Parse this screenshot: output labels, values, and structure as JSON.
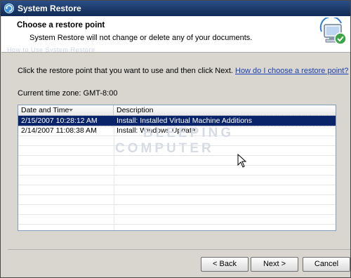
{
  "window": {
    "title": "System Restore"
  },
  "header": {
    "title": "Choose a restore point",
    "subtitle": "System Restore will not change or delete any of your documents.",
    "watermark": "How to Use System Restore"
  },
  "instruction": {
    "text": "Click the restore point that you want to use and then click Next.",
    "link": "How do I choose a restore point?"
  },
  "timezone": "Current time zone: GMT-8:00",
  "list": {
    "columns": [
      "Date and Time",
      "Description"
    ],
    "rows": [
      {
        "date": "2/15/2007 10:28:12 AM",
        "description": "Install: Installed Virtual Machine Additions",
        "selected": true
      },
      {
        "date": "2/14/2007 11:08:38 AM",
        "description": "Install: Windows Update",
        "selected": false
      }
    ]
  },
  "watermark": {
    "line1": "BLEEPING",
    "line2": "COMPUTER"
  },
  "buttons": {
    "back": "< Back",
    "next": "Next >",
    "cancel": "Cancel"
  },
  "colors": {
    "selection": "#0a246a",
    "link": "#1a3fb0",
    "title_bar": "#1c3a6a"
  }
}
